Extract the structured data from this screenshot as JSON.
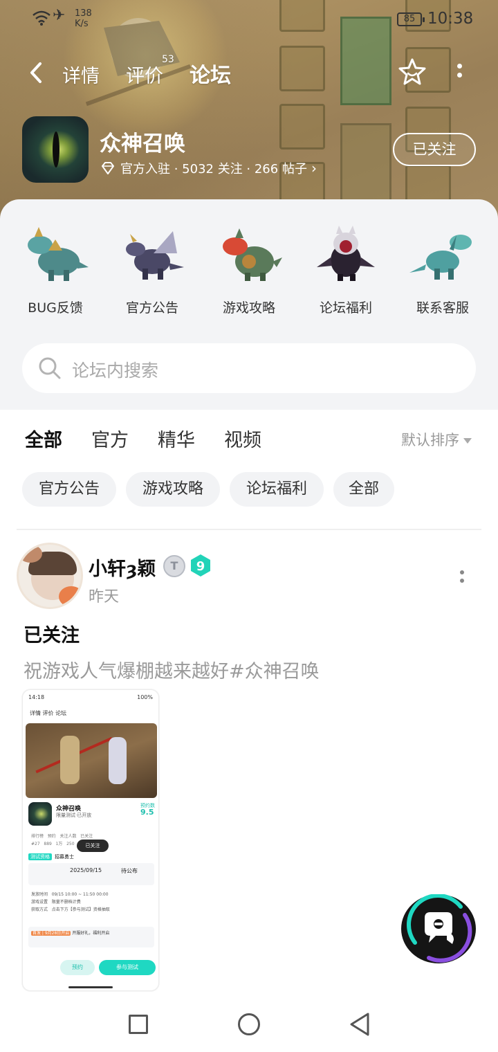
{
  "status_bar": {
    "speed": "138",
    "speed_unit": "K/s",
    "battery": "85",
    "time": "10:38"
  },
  "nav": {
    "tabs": [
      {
        "label": "详情"
      },
      {
        "label": "评价",
        "count": "53"
      },
      {
        "label": "论坛"
      }
    ]
  },
  "game": {
    "name": "众神召唤",
    "meta": "官方入驻 · 5032 关注 · 266 帖子",
    "follow_label": "已关注"
  },
  "categories": [
    {
      "label": "BUG反馈"
    },
    {
      "label": "官方公告"
    },
    {
      "label": "游戏攻略"
    },
    {
      "label": "论坛福利"
    },
    {
      "label": "联系客服"
    }
  ],
  "search": {
    "placeholder": "论坛内搜索"
  },
  "filter_tabs": [
    {
      "label": "全部"
    },
    {
      "label": "官方"
    },
    {
      "label": "精华"
    },
    {
      "label": "视频"
    }
  ],
  "sort_label": "默认排序",
  "chips": [
    {
      "label": "官方公告"
    },
    {
      "label": "游戏攻略"
    },
    {
      "label": "论坛福利"
    },
    {
      "label": "全部"
    }
  ],
  "post": {
    "username": "小轩ȝ颖",
    "badge_letter": "T",
    "badge_level": "9",
    "time": "昨天",
    "title": "已关注",
    "body": "祝游戏人气爆棚越来越好#众神召唤",
    "image": {
      "status_time": "14:18",
      "status_right": "100%",
      "nav": "详情   评价   论坛",
      "game_name": "众神召唤",
      "game_sub": "限量测试·已开放",
      "score_label": "预约数",
      "score": "9.5",
      "stats": "排行榜   预约   关注人数   已关注\n#27   889   1万   250",
      "pill": "已关注",
      "tag_em": "测试资格",
      "tag": "招募勇士",
      "date_left": "2025/09/15",
      "date_right": "待公布",
      "lines": "发放时间   09/15 10:00 ~ 11:50 00:00\n游戏设置   限量不删档计费\n获取方式   点击下方【参与测试】资格抽取",
      "event_em": "首发 | 9月28日开启",
      "event": "开服好礼，福利开启",
      "btn1": "预约",
      "btn2": "参与测试"
    }
  },
  "colors": {
    "accent": "#1fd8c2",
    "banner": "#a88d5f",
    "panel_bg": "#f3f4f6"
  },
  "icons": {
    "back": "chevron-left-icon",
    "favorite": "star-icon",
    "more": "more-vertical-icon",
    "search": "search-icon",
    "fab": "chat-bubble-icon"
  }
}
